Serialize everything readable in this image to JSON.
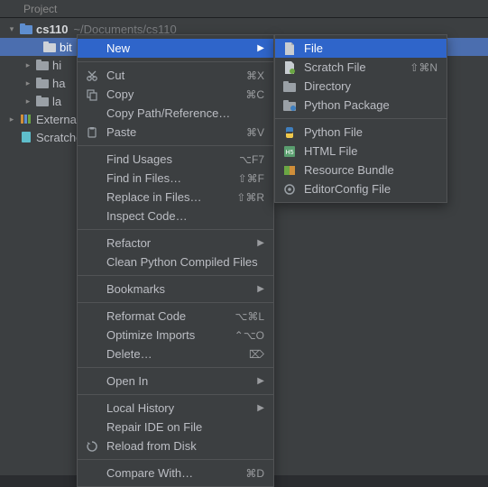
{
  "topbar": {
    "label": "Project"
  },
  "tree": {
    "root": {
      "name": "cs110",
      "path": "~/Documents/cs110"
    },
    "items": [
      "bit",
      "hi",
      "ha",
      "la"
    ],
    "external": "External Libraries",
    "scratches": "Scratches and Consoles"
  },
  "menu": {
    "new": "New",
    "cut": "Cut",
    "cut_sc": "⌘X",
    "copy": "Copy",
    "copy_sc": "⌘C",
    "copy_path": "Copy Path/Reference…",
    "paste": "Paste",
    "paste_sc": "⌘V",
    "find_usages": "Find Usages",
    "find_usages_sc": "⌥F7",
    "find_in_files": "Find in Files…",
    "find_in_files_sc": "⇧⌘F",
    "replace_in_files": "Replace in Files…",
    "replace_in_files_sc": "⇧⌘R",
    "inspect": "Inspect Code…",
    "refactor": "Refactor",
    "clean_pyc": "Clean Python Compiled Files",
    "bookmarks": "Bookmarks",
    "reformat": "Reformat Code",
    "reformat_sc": "⌥⌘L",
    "optimize": "Optimize Imports",
    "optimize_sc": "⌃⌥O",
    "delete": "Delete…",
    "delete_sc": "⌦",
    "open_in": "Open In",
    "local_history": "Local History",
    "repair_ide": "Repair IDE on File",
    "reload": "Reload from Disk",
    "compare": "Compare With…",
    "compare_sc": "⌘D"
  },
  "submenu": {
    "file": "File",
    "scratch": "Scratch File",
    "scratch_sc": "⇧⌘N",
    "directory": "Directory",
    "py_pkg": "Python Package",
    "py_file": "Python File",
    "html_file": "HTML File",
    "resource": "Resource Bundle",
    "editorconfig": "EditorConfig File"
  },
  "colors": {
    "folder_gray": "#9aa0a6",
    "folder_blue": "#5e8ecf",
    "py_blue": "#3f7fbf",
    "py_yellow": "#f0c94c",
    "html_green": "#5a9e6f",
    "bundle_1": "#6ba644",
    "bundle_2": "#d08f3a",
    "cog": "#9aa0a6",
    "orange": "#d08f3a"
  }
}
